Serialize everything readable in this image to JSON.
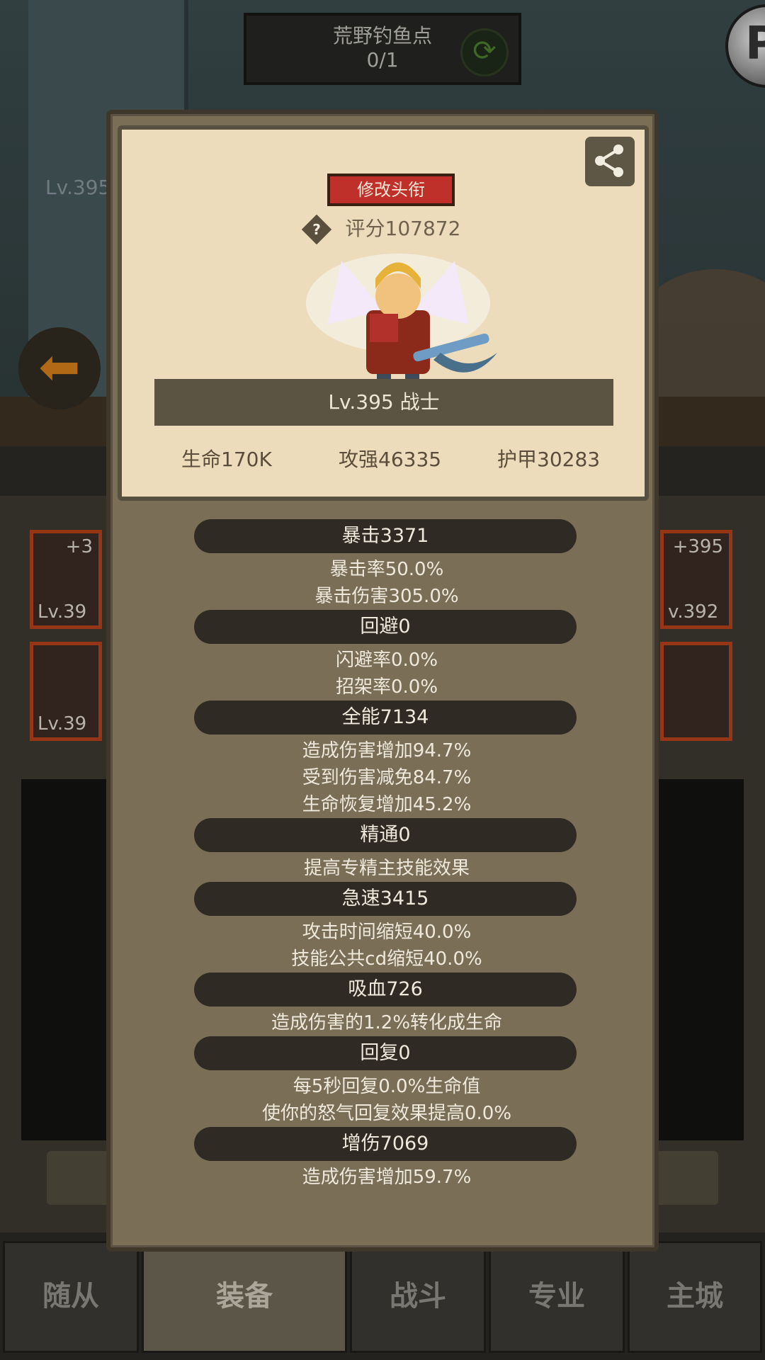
{
  "background": {
    "fishing_spot": {
      "title": "荒野钓鱼点",
      "progress": "0/1"
    },
    "left_level": "Lv.395",
    "slots": [
      {
        "plus": "+3",
        "level": "Lv.39"
      },
      {
        "plus": "",
        "level": "Lv.39"
      },
      {
        "plus": "+395",
        "level": "v.392"
      },
      {
        "plus": "",
        "level": ""
      }
    ],
    "nav": {
      "tabs": [
        {
          "label": "随从"
        },
        {
          "label": "装备"
        },
        {
          "label": "战斗"
        },
        {
          "label": "专业"
        },
        {
          "label": "主城"
        }
      ],
      "active": "装备"
    }
  },
  "modal": {
    "card": {
      "title_button": "修改头衔",
      "score": "评分107872",
      "score_help_icon": "?",
      "level_class": "Lv.395 战士",
      "stats": {
        "hp": "生命170K",
        "attack": "攻强46335",
        "armor": "护甲30283"
      }
    },
    "stat_groups": [
      {
        "header": "暴击3371",
        "lines": [
          "暴击率50.0%",
          "暴击伤害305.0%"
        ]
      },
      {
        "header": "回避0",
        "lines": [
          "闪避率0.0%",
          "招架率0.0%"
        ]
      },
      {
        "header": "全能7134",
        "lines": [
          "造成伤害增加94.7%",
          "受到伤害减免84.7%",
          "生命恢复增加45.2%"
        ]
      },
      {
        "header": "精通0",
        "lines": [
          "提高专精主技能效果"
        ]
      },
      {
        "header": "急速3415",
        "lines": [
          "攻击时间缩短40.0%",
          "技能公共cd缩短40.0%"
        ]
      },
      {
        "header": "吸血726",
        "lines": [
          "造成伤害的1.2%转化成生命"
        ]
      },
      {
        "header": "回复0",
        "lines": [
          "每5秒回复0.0%生命值",
          "使你的怒气回复效果提高0.0%"
        ]
      },
      {
        "header": "增伤7069",
        "lines": [
          "造成伤害增加59.7%"
        ]
      }
    ]
  }
}
